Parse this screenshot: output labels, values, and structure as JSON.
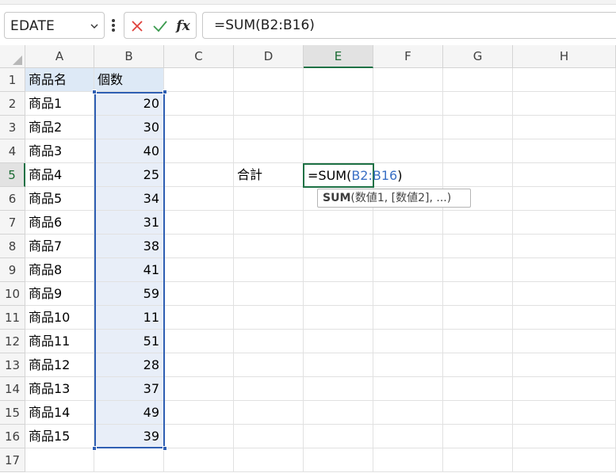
{
  "name_box": {
    "value": "EDATE"
  },
  "formula_bar": {
    "formula": "=SUM(B2:B16)",
    "cancel_icon": "cancel-x-icon",
    "enter_icon": "check-icon",
    "fx_label": "fx"
  },
  "columns": [
    "A",
    "B",
    "C",
    "D",
    "E",
    "F",
    "G",
    "H"
  ],
  "active_column": "E",
  "rows": [
    "1",
    "2",
    "3",
    "4",
    "5",
    "6",
    "7",
    "8",
    "9",
    "10",
    "11",
    "12",
    "13",
    "14",
    "15",
    "16",
    "17"
  ],
  "active_row": "5",
  "table": {
    "header": {
      "name": "商品名",
      "count": "個数"
    },
    "items": [
      {
        "name": "商品1",
        "count": "20"
      },
      {
        "name": "商品2",
        "count": "30"
      },
      {
        "name": "商品3",
        "count": "40"
      },
      {
        "name": "商品4",
        "count": "25"
      },
      {
        "name": "商品5",
        "count": "34"
      },
      {
        "name": "商品6",
        "count": "31"
      },
      {
        "name": "商品7",
        "count": "38"
      },
      {
        "name": "商品8",
        "count": "41"
      },
      {
        "name": "商品9",
        "count": "59"
      },
      {
        "name": "商品10",
        "count": "11"
      },
      {
        "name": "商品11",
        "count": "51"
      },
      {
        "name": "商品12",
        "count": "28"
      },
      {
        "name": "商品13",
        "count": "37"
      },
      {
        "name": "商品14",
        "count": "49"
      },
      {
        "name": "商品15",
        "count": "39"
      }
    ]
  },
  "total": {
    "label": "合計",
    "edit_prefix": "=SUM(",
    "edit_ref": "B2:B16",
    "edit_suffix": ")"
  },
  "tooltip": {
    "func": "SUM",
    "args": "(数値1, [数値2], ...)"
  },
  "colors": {
    "selection_border": "#2f5fb3",
    "active_cell_border": "#1e7145",
    "cancel": "#e0413b",
    "enter": "#3c9b4f"
  }
}
